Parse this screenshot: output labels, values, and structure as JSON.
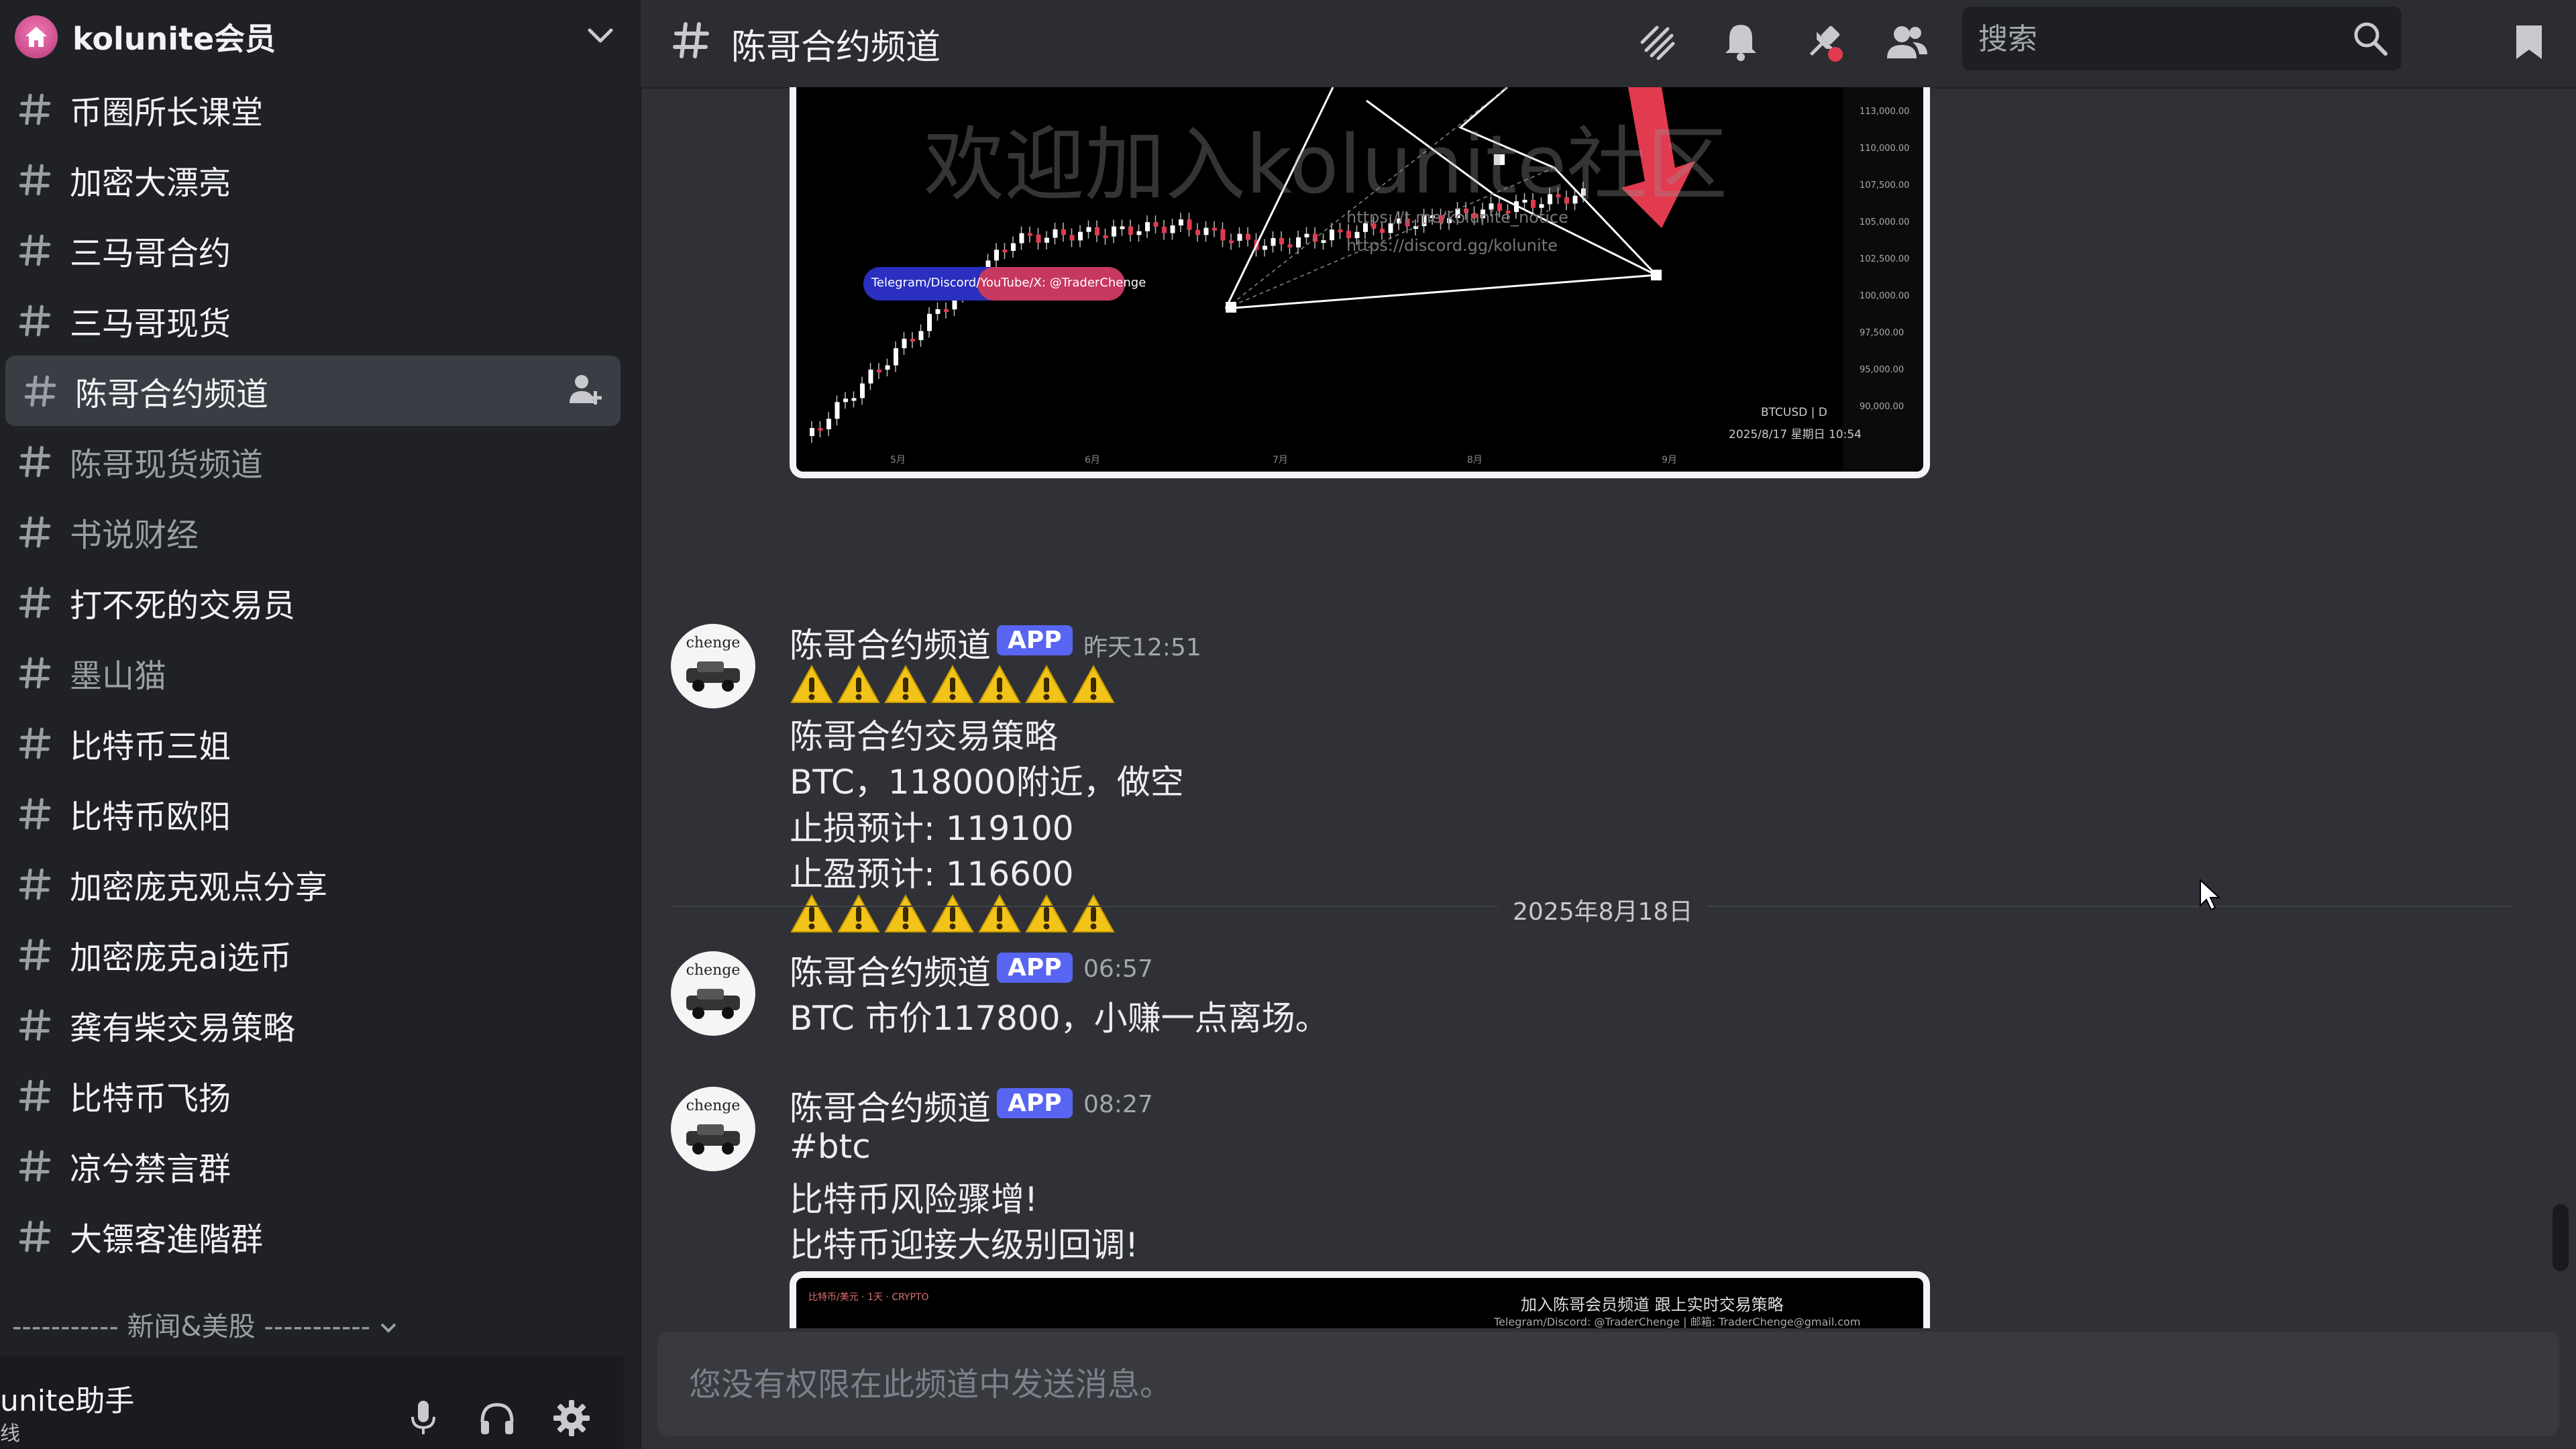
{
  "server": {
    "name": "kolunite会员"
  },
  "channels": [
    {
      "name": "币圈所长课堂",
      "state": "normal"
    },
    {
      "name": "加密大漂亮",
      "state": "normal"
    },
    {
      "name": "三马哥合约",
      "state": "normal"
    },
    {
      "name": "三马哥现货",
      "state": "normal"
    },
    {
      "name": "陈哥合约频道",
      "state": "selected"
    },
    {
      "name": "陈哥现货频道",
      "state": "muted"
    },
    {
      "name": "书说财经",
      "state": "muted"
    },
    {
      "name": "打不死的交易员",
      "state": "normal"
    },
    {
      "name": "墨山猫",
      "state": "muted"
    },
    {
      "name": "比特币三姐",
      "state": "normal"
    },
    {
      "name": "比特币欧阳",
      "state": "normal"
    },
    {
      "name": "加密庞克观点分享",
      "state": "normal"
    },
    {
      "name": "加密庞克ai选币",
      "state": "normal"
    },
    {
      "name": "龚有柴交易策略",
      "state": "normal"
    },
    {
      "name": "比特币飞扬",
      "state": "normal"
    },
    {
      "name": "凉兮禁言群",
      "state": "normal"
    },
    {
      "name": "大镖客進階群",
      "state": "normal"
    }
  ],
  "category": {
    "label": "----------- 新闻&美股 -----------"
  },
  "user_panel": {
    "name": "unite助手",
    "status": "线"
  },
  "topbar": {
    "channel_title": "陈哥合约频道",
    "search_placeholder": "搜索"
  },
  "chart_image": {
    "watermark": "欢迎加入kolunite社区",
    "banner": "Telegram/Discord/YouTube/X: @TraderChenge",
    "symbol": "BTCUSD | D",
    "date": "2025/8/17 星期日 10:54",
    "link1": "https://t.me/kolunite_notice",
    "link2": "https://discord.gg/kolunite"
  },
  "messages": [
    {
      "author": "陈哥合约频道",
      "badge": "APP",
      "time": "昨天12:51",
      "avatar_text": "chenge",
      "lines": [
        "陈哥合约交易策略",
        "BTC，118000附近，做空",
        "止损预计: 119100",
        "止盈预计: 116600"
      ]
    },
    {
      "author": "陈哥合约频道",
      "badge": "APP",
      "time": "06:57",
      "avatar_text": "chenge",
      "lines": [
        "BTC 市价117800，小赚一点离场。"
      ]
    },
    {
      "author": "陈哥合约频道",
      "badge": "APP",
      "time": "08:27",
      "avatar_text": "chenge",
      "lines": [
        "#btc",
        "比特币风险骤增!",
        "比特币迎接大级别回调!"
      ]
    }
  ],
  "date_separator": "2025年8月18日",
  "chart_image2": {
    "title": "加入陈哥会员频道  跟上实时交易策略",
    "subtitle": "Telegram/Discord: @TraderChenge | 邮箱: TraderChenge@gmail.com",
    "ticker": "比特币/美元 · 1天 · CRYPTO"
  },
  "composer": {
    "placeholder": "您没有权限在此频道中发送消息。"
  },
  "colors": {
    "accent": "#5865f2",
    "alert": "#e23a4f",
    "warning": "#f2c318"
  },
  "icons": [
    "home-icon",
    "chevron-down-icon",
    "hash-icon",
    "add-member-icon",
    "mic-icon",
    "headphones-icon",
    "gear-icon",
    "threads-icon",
    "bell-icon",
    "pin-icon",
    "members-icon",
    "search-icon",
    "bookmark-icon",
    "warning-icon"
  ]
}
